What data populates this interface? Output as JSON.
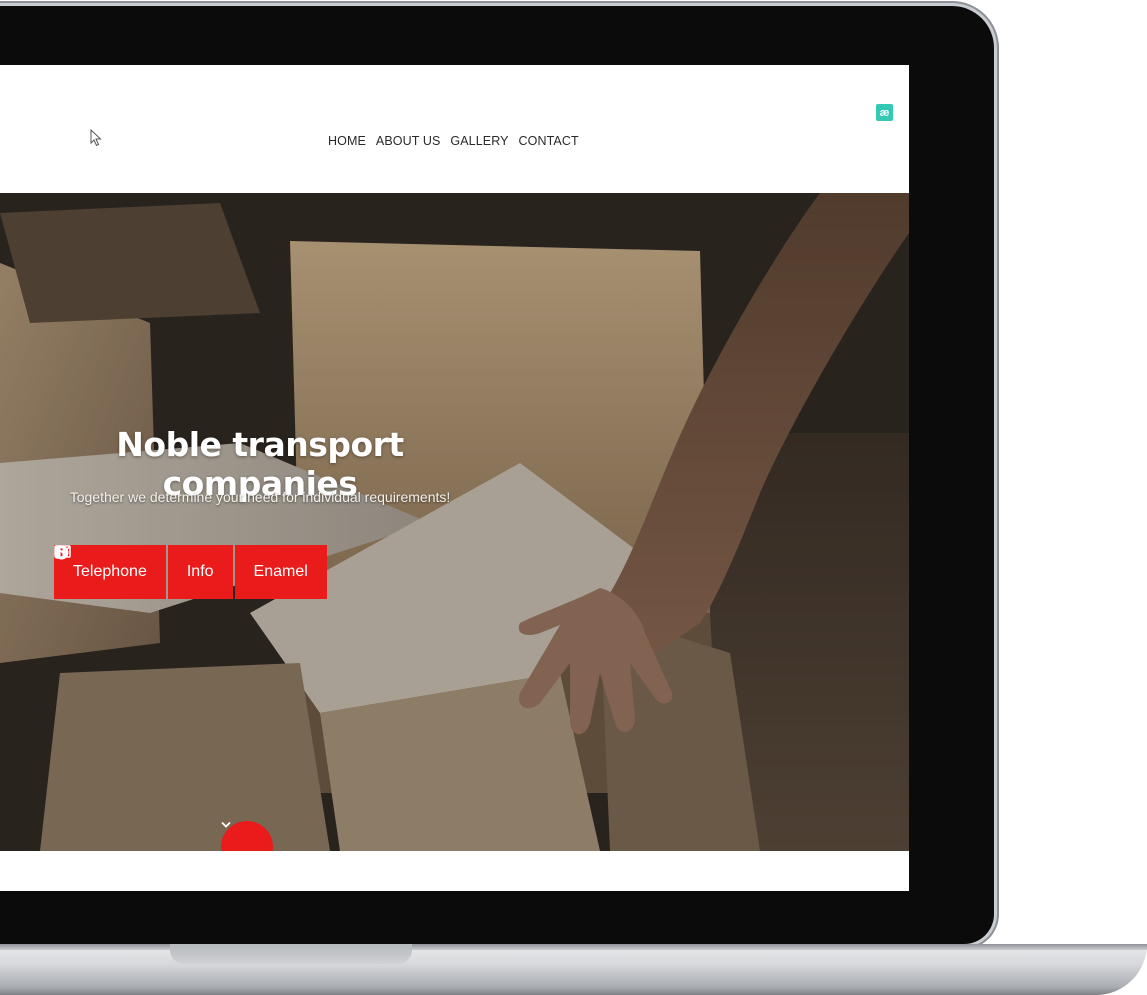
{
  "header": {
    "nav": [
      {
        "label": "HOME"
      },
      {
        "label": "ABOUT US"
      },
      {
        "label": "GALLERY"
      },
      {
        "label": "CONTACT"
      }
    ],
    "brand_badge": "æ",
    "icons": [
      "cursor-arrow-icon"
    ]
  },
  "hero": {
    "title": "Noble transport companies",
    "subtitle": "Together we determine your need for individual requirements!",
    "buttons": [
      {
        "label": "Telephone",
        "icon": "mobile-phone-icon"
      },
      {
        "label": "Info",
        "icon": "info-circle-icon"
      },
      {
        "label": "Enamel",
        "icon": "envelope-icon"
      }
    ],
    "scroll_icon": "chevron-down-icon"
  },
  "colors": {
    "accent": "#ea1b1b",
    "badge": "#33c9b5",
    "bezel": "#0b0b0b"
  }
}
